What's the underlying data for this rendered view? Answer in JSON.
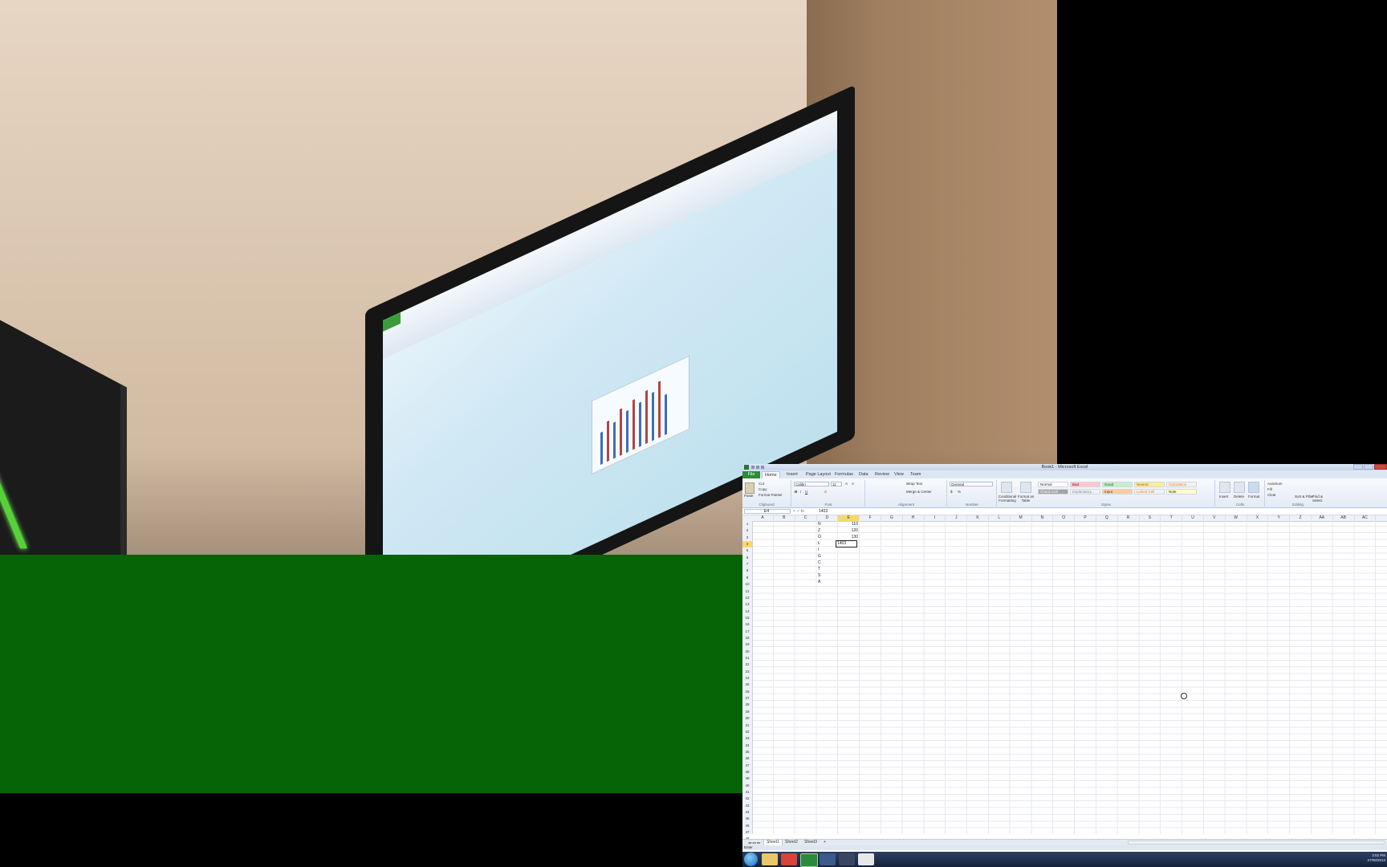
{
  "excel": {
    "window_title": "Book1 - Microsoft Excel",
    "tabs": [
      "File",
      "Home",
      "Insert",
      "Page Layout",
      "Formulas",
      "Data",
      "Review",
      "View",
      "Team"
    ],
    "active_tab": "Home",
    "clipboard": {
      "paste": "Paste",
      "cut": "Cut",
      "copy": "Copy",
      "format_painter": "Format Painter",
      "group": "Clipboard"
    },
    "font": {
      "name": "Calibri",
      "size": "11",
      "group": "Font"
    },
    "alignment": {
      "wrap": "Wrap Text",
      "merge": "Merge & Center",
      "group": "Alignment"
    },
    "number": {
      "format": "General",
      "group": "Number"
    },
    "styles": {
      "items": [
        "Normal",
        "Bad",
        "Good",
        "Neutral",
        "Calculation",
        "Check Cell",
        "Explanatory...",
        "Input",
        "Linked Cell",
        "Note"
      ],
      "conditional": "Conditional Formatting",
      "format_table": "Format as Table",
      "group": "Styles"
    },
    "cells": {
      "insert": "Insert",
      "delete": "Delete",
      "format": "Format",
      "group": "Cells"
    },
    "editing": {
      "autosum": "AutoSum",
      "fill": "Fill",
      "clear": "Clear",
      "sort": "Sort & Filter",
      "find": "Find & Select",
      "group": "Editing"
    },
    "name_box": "E4",
    "formula_value": "1403",
    "columns": [
      "A",
      "B",
      "C",
      "D",
      "E",
      "F",
      "G",
      "H",
      "I",
      "J",
      "K",
      "L",
      "M",
      "N",
      "O",
      "P",
      "Q",
      "R",
      "S",
      "T",
      "U",
      "V",
      "W",
      "X",
      "Y",
      "Z",
      "AA",
      "AB",
      "AC"
    ],
    "rows": [
      "1",
      "2",
      "3",
      "4",
      "5",
      "6",
      "7",
      "8",
      "9",
      "10",
      "11",
      "12",
      "13",
      "14",
      "15",
      "16",
      "17",
      "18",
      "19",
      "20",
      "21",
      "22",
      "23",
      "24",
      "25",
      "26",
      "27",
      "28",
      "29",
      "30",
      "31",
      "32",
      "33",
      "34",
      "35",
      "36",
      "37",
      "38",
      "39",
      "40",
      "41",
      "42",
      "43",
      "44",
      "45",
      "46",
      "47",
      "48"
    ],
    "column_d": [
      "N",
      "Z",
      "O",
      "L",
      "I",
      "G",
      "C",
      "T",
      "S",
      "A"
    ],
    "column_e": [
      "110",
      "120",
      "130"
    ],
    "active_cell_value": "1403",
    "sheets": [
      "Sheet1",
      "Sheet2",
      "Sheet3"
    ],
    "status": "Enter"
  },
  "taskbar": {
    "time": "3:02 PM",
    "date": "27/08/2013"
  }
}
